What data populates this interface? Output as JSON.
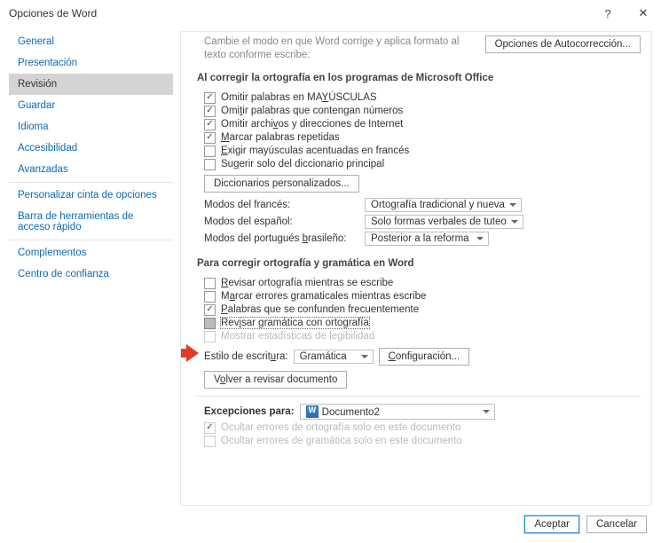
{
  "window": {
    "title": "Opciones de Word",
    "help": "?",
    "close": "✕"
  },
  "sidebar": {
    "items": [
      {
        "label": "General"
      },
      {
        "label": "Presentación"
      },
      {
        "label": "Revisión",
        "selected": true
      },
      {
        "label": "Guardar"
      },
      {
        "label": "Idioma"
      },
      {
        "label": "Accesibilidad"
      },
      {
        "label": "Avanzadas"
      },
      {
        "label": "Personalizar cinta de opciones"
      },
      {
        "label": "Barra de herramientas de acceso rápido"
      },
      {
        "label": "Complementos"
      },
      {
        "label": "Centro de confianza"
      }
    ]
  },
  "topLead": "Cambie el modo en que Word corrige y aplica formato al texto conforme escribe:",
  "autoCorrectBtn": "Opciones de Autocorrección...",
  "section1": {
    "title": "Al corregir la ortografía en los programas de Microsoft Office",
    "chk1": {
      "label": "Omitir palabras en MAYÚSCULAS",
      "checked": true,
      "u": "Y"
    },
    "chk2": {
      "label": "Omitir palabras que contengan números",
      "checked": true,
      "u": "n"
    },
    "chk3": {
      "label": "Omitir archivos y direcciones de Internet",
      "checked": true,
      "u": "v"
    },
    "chk4": {
      "label": "Marcar palabras repetidas",
      "checked": true,
      "u": "M"
    },
    "chk5": {
      "label": "Exigir mayúsculas acentuadas en francés",
      "checked": false,
      "u": "E"
    },
    "chk6": {
      "label": "Sugerir solo del diccionario principal",
      "checked": false,
      "u": "g"
    },
    "dictBtn": "Diccionarios personalizados...",
    "french": {
      "label": "Modos del francés:",
      "value": "Ortografía tradicional y nueva"
    },
    "spanish": {
      "label": "Modos del español:",
      "value": "Solo formas verbales de tuteo"
    },
    "portuguese": {
      "label": "Modos del portugués brasileño:",
      "value": "Posterior a la reforma"
    }
  },
  "section2": {
    "title": "Para corregir ortografía y gramática en Word",
    "chk1": {
      "label": "Revisar ortografía mientras se escribe",
      "checked": false,
      "u": "R"
    },
    "chk2": {
      "label": "Marcar errores gramaticales mientras escribe",
      "checked": false,
      "u": "a"
    },
    "chk3": {
      "label": "Palabras que se confunden frecuentemente",
      "checked": true,
      "u": "P"
    },
    "chk4": {
      "label": "Revisar gramática con ortografía",
      "checked": "mixed",
      "u": "i"
    },
    "chk5": {
      "label": "Mostrar estadísticas de legibilidad",
      "checked": false,
      "disabled": true
    },
    "style": {
      "label": "Estilo de escritura:",
      "value": "Gramática",
      "btn": "Configuración..."
    },
    "recheckBtn": "Volver a revisar documento"
  },
  "section3": {
    "title": "Excepciones para:",
    "doc": "Documento2",
    "chk1": {
      "label": "Ocultar errores de ortografía solo en este documento",
      "checked": true,
      "disabled": true
    },
    "chk2": {
      "label": "Ocultar errores de gramática solo en este documento",
      "checked": false,
      "disabled": true
    }
  },
  "footer": {
    "ok": "Aceptar",
    "cancel": "Cancelar"
  }
}
